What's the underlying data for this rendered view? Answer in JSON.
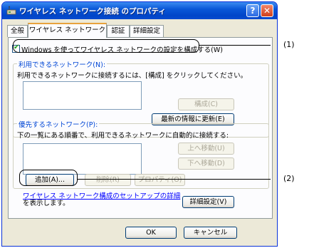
{
  "window": {
    "title": "ワイヤレス ネットワーク接続 のプロパティ",
    "help_label": "?",
    "close_label": "✕"
  },
  "tabs": [
    {
      "label": "全般",
      "active": false
    },
    {
      "label": "ワイヤレス ネットワーク",
      "active": true
    },
    {
      "label": "認証",
      "active": false
    },
    {
      "label": "詳細設定",
      "active": false
    }
  ],
  "use_windows_checkbox": {
    "label": "Windows を使ってワイヤレス ネットワークの設定を構成する(W)",
    "checked": true,
    "check_glyph": "✔"
  },
  "available_networks": {
    "title": "利用できるネットワーク(N):",
    "description": "利用できるネットワークに接続するには、[構成] をクリックしてください。",
    "configure_button": "構成(C)",
    "refresh_button": "最新の情報に更新(E)"
  },
  "preferred_networks": {
    "title": "優先するネットワーク(P):",
    "description": "下の一覧にある順番で、利用できるネットワークに自動的に接続する:",
    "move_up_button": "上へ移動(U)",
    "move_down_button": "下へ移動(D)",
    "add_button": "追加(A)...",
    "remove_button": "削除(R)",
    "properties_button": "プロパティ(O)"
  },
  "setup_link": {
    "line1": "ワイヤレス ネットワーク構成のセットアップの詳細",
    "line2": "を表示します。"
  },
  "advanced_button": "詳細設定(V)",
  "ok_button": "OK",
  "cancel_button": "キャンセル",
  "callouts": {
    "first": "(1)",
    "second": "(2)"
  },
  "colors": {
    "titlebar": "#0a58d8",
    "group_title": "#0046d5",
    "link": "#0000ff",
    "active_tab_accent": "#e8a33c"
  }
}
